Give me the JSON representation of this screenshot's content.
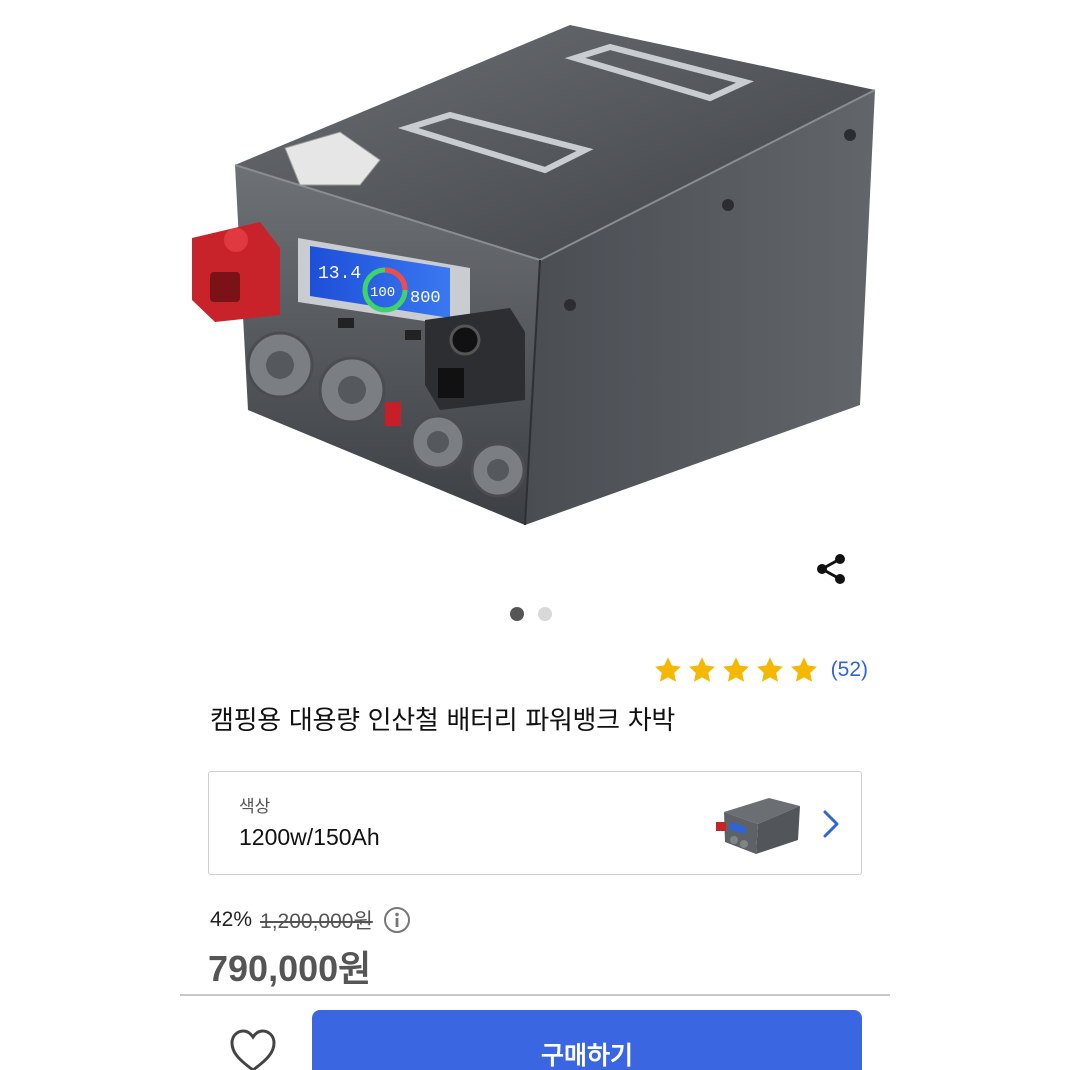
{
  "product": {
    "title": "캠핑용 대용량 인산철 배터리 파워뱅크 차박",
    "image_alt": "battery-power-bank-photo",
    "lcd_voltage": "13.4",
    "lcd_percent": "100",
    "lcd_watts": "800"
  },
  "gallery": {
    "total": 2,
    "active_index": 0
  },
  "rating": {
    "stars": 5,
    "review_count": "(52)"
  },
  "option": {
    "label": "색상",
    "value": "1200w/150Ah"
  },
  "price": {
    "discount": "42%",
    "original": "1,200,000원",
    "sale": "790,000원"
  },
  "actions": {
    "buy_label": "구매하기"
  },
  "icons": {
    "share": "share-icon",
    "star": "star-icon",
    "info": "info-icon",
    "chevron": "chevron-right-icon",
    "heart": "heart-outline-icon"
  },
  "colors": {
    "accent": "#3a66e2",
    "star": "#f5b800",
    "review_link": "#2f64d6",
    "battery_body": "#5a5d62",
    "terminal_red": "#c8232b"
  }
}
